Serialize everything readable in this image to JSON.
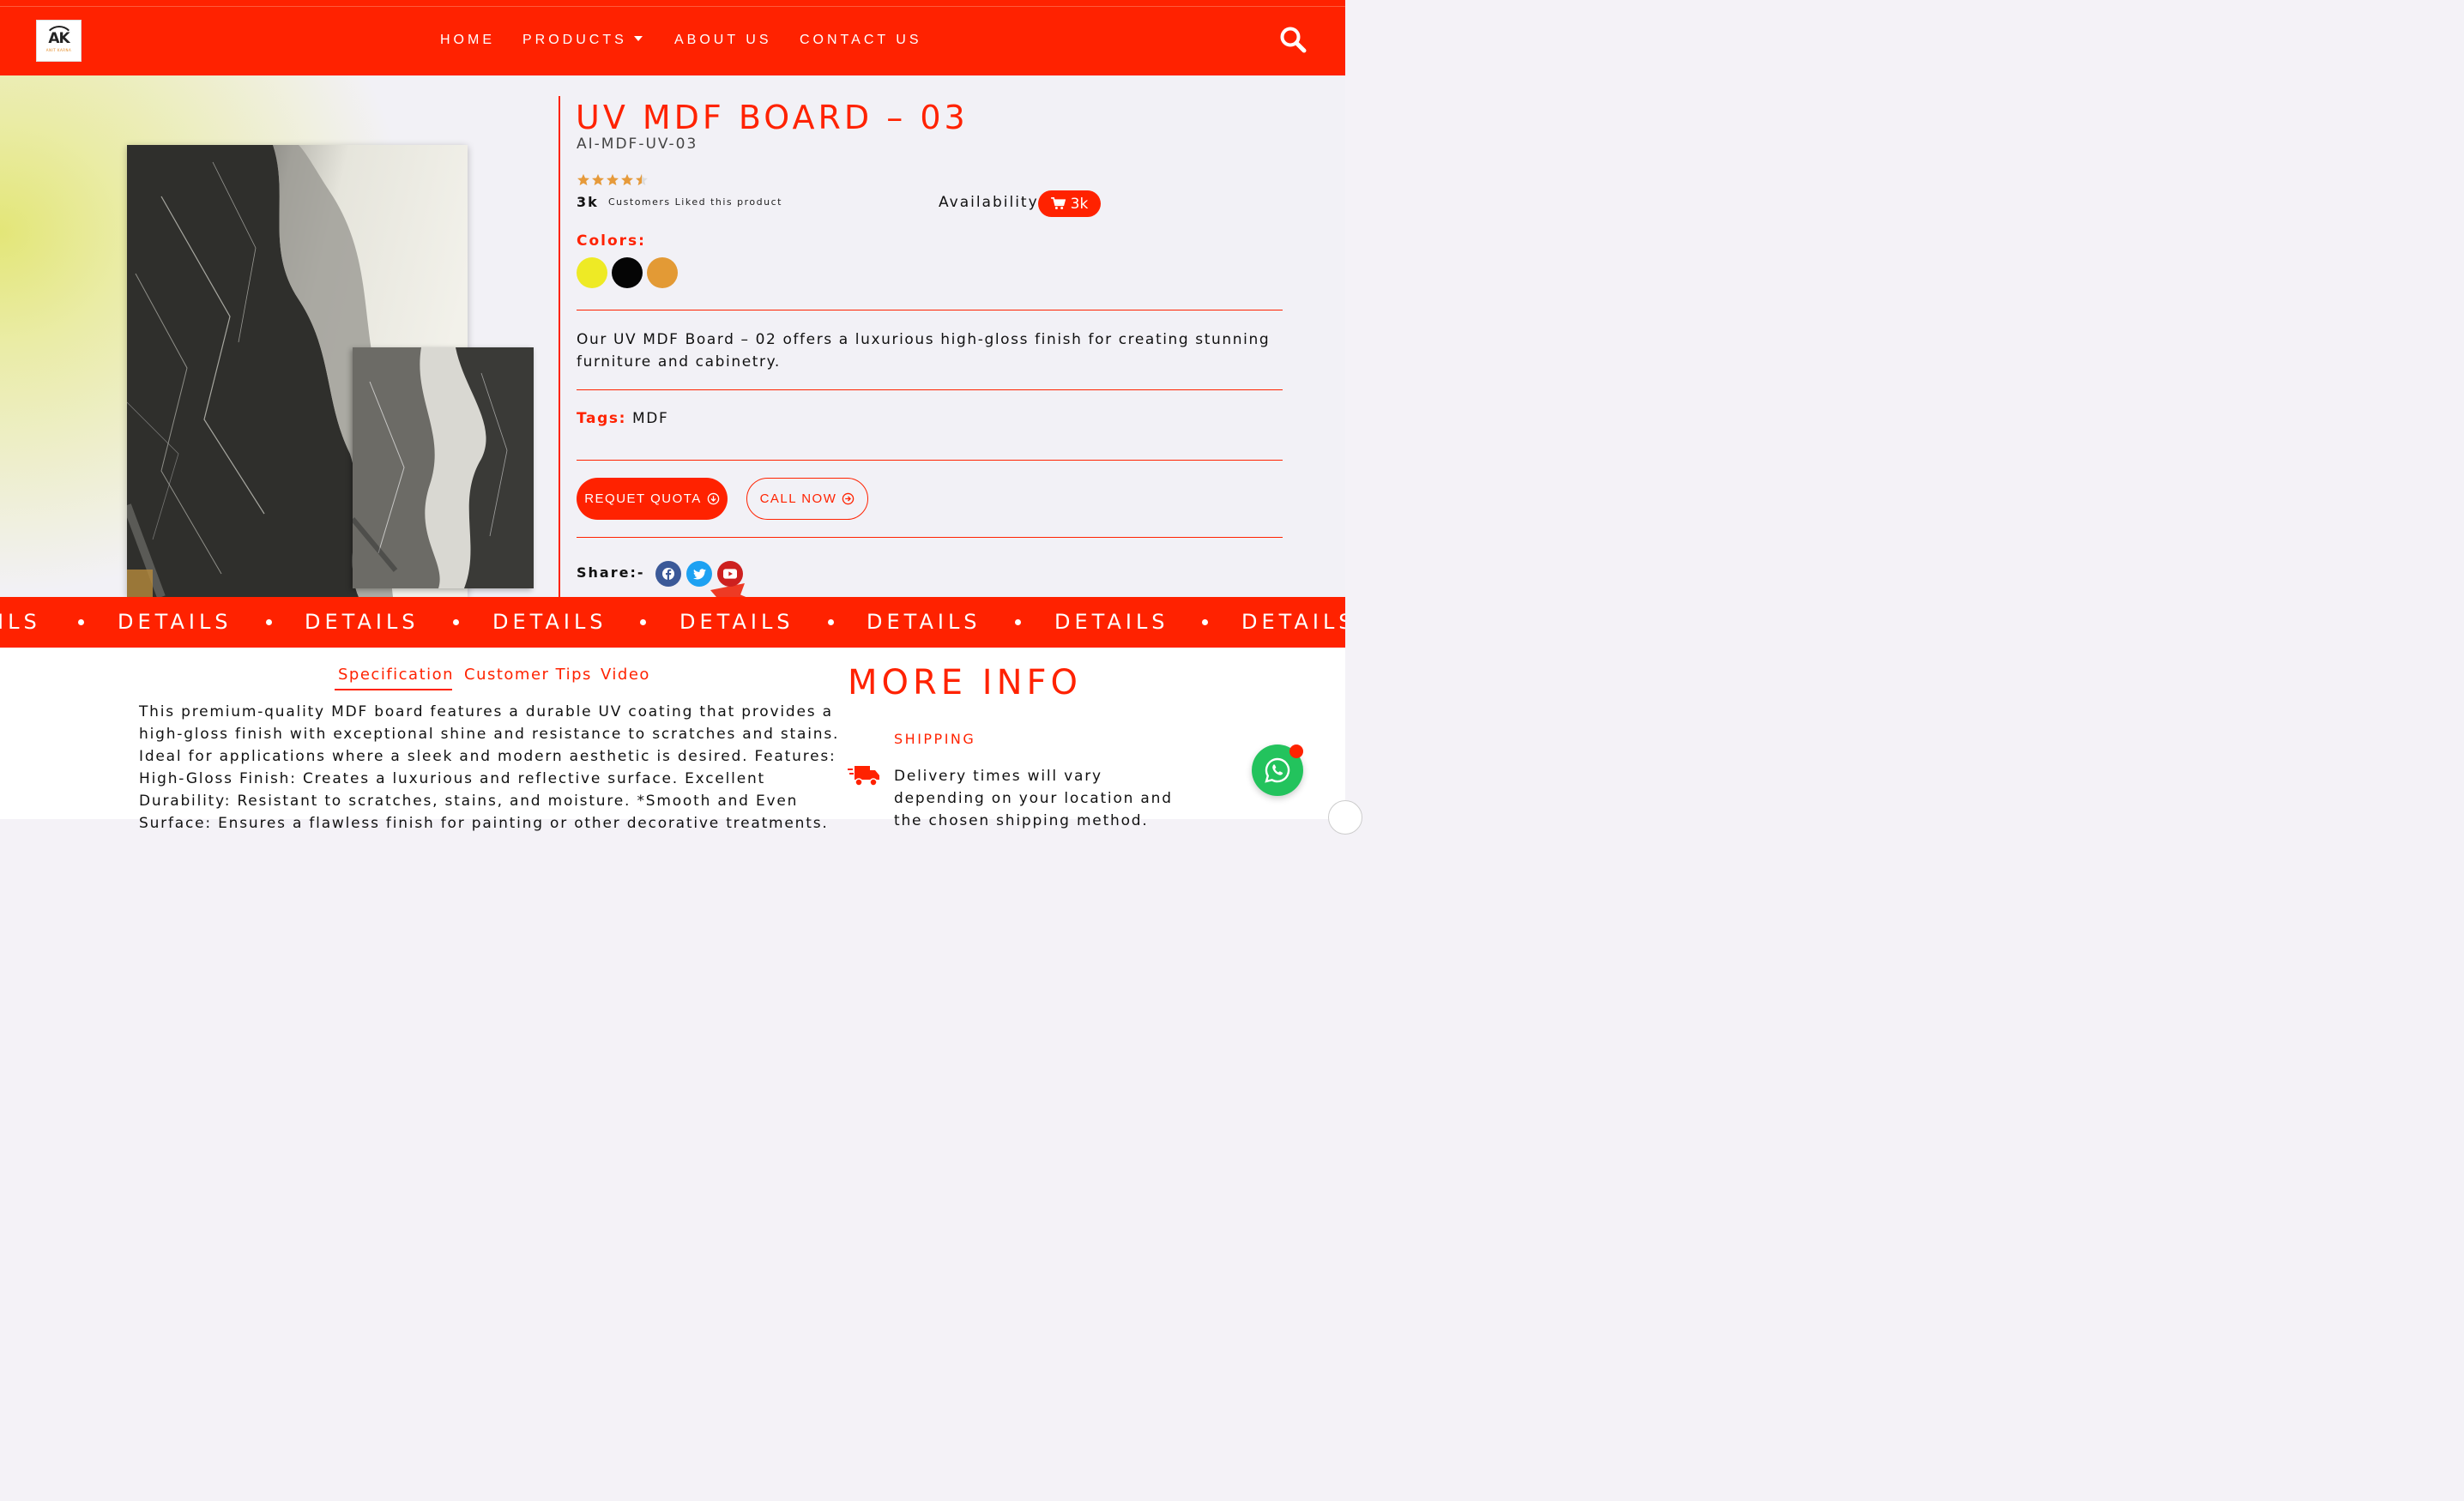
{
  "brand": {
    "logo_text": "AK",
    "logo_tagline": "ANIT KARNA",
    "accent_color": "#ff2200"
  },
  "nav": {
    "items": [
      {
        "label": "HOME"
      },
      {
        "label": "PRODUCTS",
        "has_dropdown": true
      },
      {
        "label": "ABOUT US"
      },
      {
        "label": "CONTACT US"
      }
    ],
    "search_icon": "search-icon"
  },
  "product": {
    "title": "UV MDF BOARD – 03",
    "sku": "AI-MDF-UV-03",
    "rating": 4.5,
    "rating_max": 5,
    "likes_count": "3k",
    "likes_label": "Customers Liked this product",
    "availability_label": "Availability",
    "availability_value": "3k",
    "colors_label": "Colors:",
    "colors": [
      "#eeea25",
      "#050505",
      "#e39a35"
    ],
    "description": "Our UV MDF Board – 02 offers a luxurious high-gloss finish for creating stunning furniture and cabinetry.",
    "tags_label": "Tags:",
    "tags_value": "MDF",
    "quota_button": "REQUET QUOTA",
    "call_button": "CALL NOW",
    "share_label": "Share:-",
    "social": [
      {
        "icon": "facebook-icon",
        "color": "#3b5998"
      },
      {
        "icon": "twitter-icon",
        "color": "#1da1f2"
      },
      {
        "icon": "youtube-icon",
        "color": "#cd201f"
      }
    ]
  },
  "marquee": {
    "items": [
      "ILS",
      "DETAILS",
      "DETAILS",
      "DETAILS",
      "DETAILS",
      "DETAILS",
      "DETAILS",
      "DETAILS"
    ]
  },
  "tabs": {
    "items": [
      "Specification",
      "Customer Tips",
      "Video"
    ],
    "active_index": 0
  },
  "specification": {
    "text": "This premium-quality MDF board features a durable UV coating that provides a high-gloss finish with exceptional shine and resistance to scratches and stains. Ideal for applications where a sleek and modern aesthetic is desired. Features: High-Gloss Finish: Creates a luxurious and reflective surface. Excellent Durability: Resistant to scratches, stains, and moisture. *Smooth and Even Surface: Ensures a flawless finish for painting or other decorative treatments."
  },
  "more_info": {
    "heading": "MORE INFO",
    "shipping_label": "SHIPPING",
    "shipping_text": "Delivery times will vary depending on your location and the chosen shipping method."
  },
  "chat": {
    "icon": "whatsapp-icon",
    "color": "#23c35d"
  }
}
